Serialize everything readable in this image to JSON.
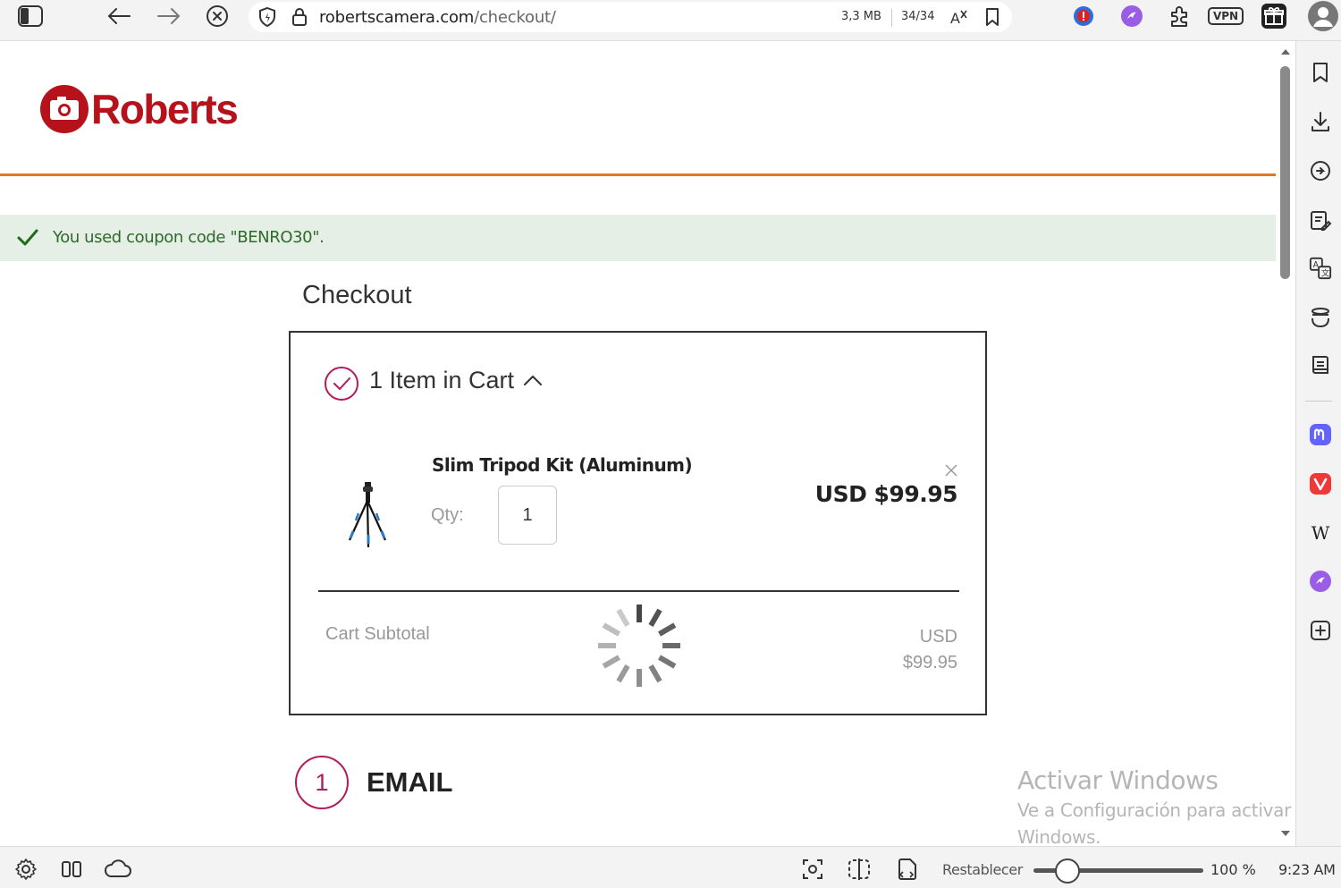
{
  "browser": {
    "url_domain": "robertscamera.com",
    "url_path": "/checkout/",
    "memory": "3,3 MB",
    "tab_count": "34/34",
    "vpn_label": "VPN"
  },
  "page": {
    "logo_text": "Roberts",
    "coupon_message": "You used coupon code \"BENRO30\".",
    "checkout_title": "Checkout",
    "cart": {
      "heading": "1 Item in Cart",
      "item": {
        "name": "Slim Tripod Kit (Aluminum)",
        "qty_label": "Qty:",
        "qty_value": "1",
        "price": "USD $99.95"
      },
      "subtotal_label": "Cart Subtotal",
      "subtotal_currency": "USD",
      "subtotal_amount": "$99.95"
    },
    "email_step_number": "1",
    "email_step_title": "EMAIL"
  },
  "watermark": {
    "title": "Activar Windows",
    "subtitle": "Ve a Configuración para activar Windows."
  },
  "statusbar": {
    "reset_label": "Restablecer",
    "zoom": "100 %",
    "time": "9:23 AM",
    "zoom_level": 0.2
  },
  "colors": {
    "brand_red": "#b5121b",
    "accent_orange": "#e87722",
    "step_magenta": "#b01c5c",
    "success_bg": "#e5efe5",
    "success_text": "#2e6b2b"
  }
}
